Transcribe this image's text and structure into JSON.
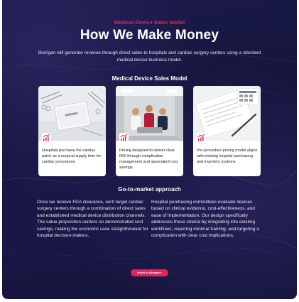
{
  "hero": {
    "eyebrow": "Medical Device Sales Model",
    "title": "How We Make Money",
    "subtitle": "BioXgen will generate revenue through direct sales to hospitals and cardiac surgery centers using a standard medical device business model."
  },
  "model_section": {
    "title": "Medical Device Sales Model",
    "cards": [
      {
        "text": "Hospitals purchase the cardiac patch as a surgical supply item for cardiac procedures",
        "icon": "growth-chart-icon"
      },
      {
        "text": "Pricing designed to deliver clear ROI through complication management and associated cost savings",
        "icon": "growth-chart-icon"
      },
      {
        "text": "Per-procedure pricing model aligns with existing hospital purchasing and inventory systems",
        "icon": "growth-chart-icon"
      }
    ]
  },
  "gtm_section": {
    "title": "Go-to-market approach",
    "left": "Once we receive FDA clearance, we'll target cardiac surgery centers through a combination of direct sales and established medical device distribution channels. The value proposition centers on demonstrated cost savings, making the economic case straightforward for hospital decision-makers.",
    "right": "Hospital purchasing committees evaluate devices based on clinical evidence, cost-effectiveness, and ease of implementation. Our design specifically addresses these criteria by integrating into existing workflows, requiring minimal training, and targeting a complication with clear cost implications."
  },
  "cta": {
    "label": "Invest in Bioxgen ›"
  },
  "colors": {
    "accent": "#e0245e",
    "background": "#16163f",
    "card": "#ffffff"
  }
}
